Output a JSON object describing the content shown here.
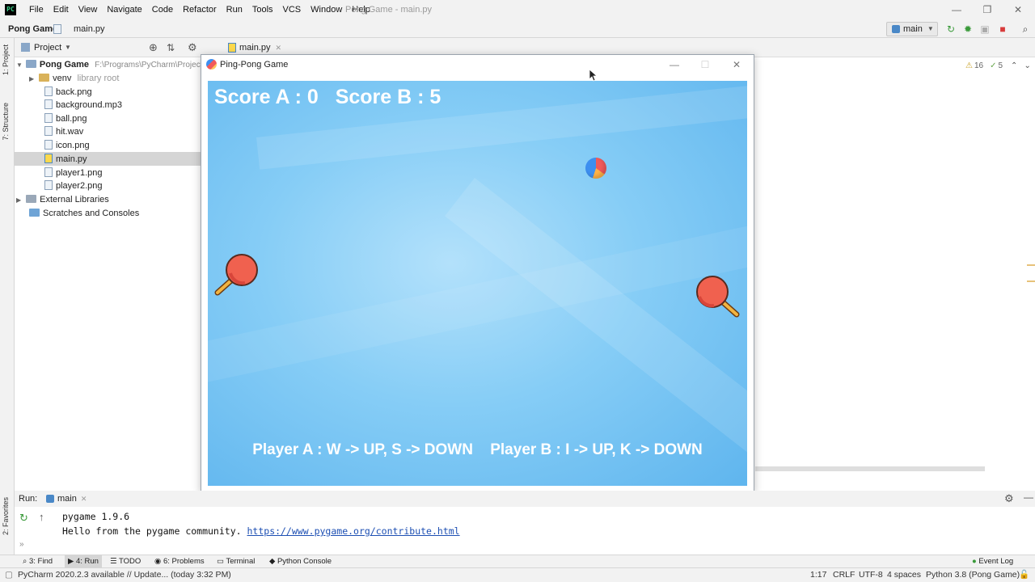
{
  "menubar": {
    "items": [
      "File",
      "Edit",
      "View",
      "Navigate",
      "Code",
      "Refactor",
      "Run",
      "Tools",
      "VCS",
      "Window",
      "Help"
    ],
    "title": "Pong Game - main.py"
  },
  "navbar": {
    "project": "Pong Game",
    "file": "main.py"
  },
  "toolbar": {
    "run_config": "main"
  },
  "side_tabs": {
    "project": "1: Project",
    "structure": "7: Structure",
    "favorites": "2: Favorites"
  },
  "project_panel": {
    "header": "Project",
    "root": {
      "name": "Pong Game",
      "path": "F:\\Programs\\PyCharm\\Projects\\"
    },
    "venv": {
      "name": "venv",
      "note": "library root"
    },
    "files": [
      "back.png",
      "background.mp3",
      "ball.png",
      "hit.wav",
      "icon.png",
      "main.py",
      "player1.png",
      "player2.png"
    ],
    "selected": "main.py",
    "external": "External Libraries",
    "scratches": "Scratches and Consoles"
  },
  "editor": {
    "tab": "main.py",
    "warnings": "16",
    "weak_warnings": "5"
  },
  "game_window": {
    "title": "Ping-Pong Game",
    "score_a": "Score A : 0",
    "score_b": "Score B : 5",
    "instr_a": "Player A : W -> UP, S -> DOWN",
    "instr_b": "Player B : I -> UP, K -> DOWN"
  },
  "run_panel": {
    "label": "Run:",
    "tab": "main",
    "line1": "pygame 1.9.6",
    "line2": "Hello from the pygame community.",
    "link": "https://www.pygame.org/contribute.html"
  },
  "tool_tabs": {
    "find": "3: Find",
    "run": "4: Run",
    "todo": "TODO",
    "problems": "6: Problems",
    "terminal": "Terminal",
    "python_console": "Python Console",
    "event_log": "Event Log"
  },
  "status": {
    "message": "PyCharm 2020.2.3 available // Update... (today 3:32 PM)",
    "position": "1:17",
    "line_sep": "CRLF",
    "encoding": "UTF-8",
    "indent": "4 spaces",
    "interpreter": "Python 3.8 (Pong Game)"
  },
  "colors": {
    "accent": "#4a88c7",
    "canvas": "#86cdf6",
    "paddle": "#f0614f",
    "selection": "#d5d5d5"
  }
}
